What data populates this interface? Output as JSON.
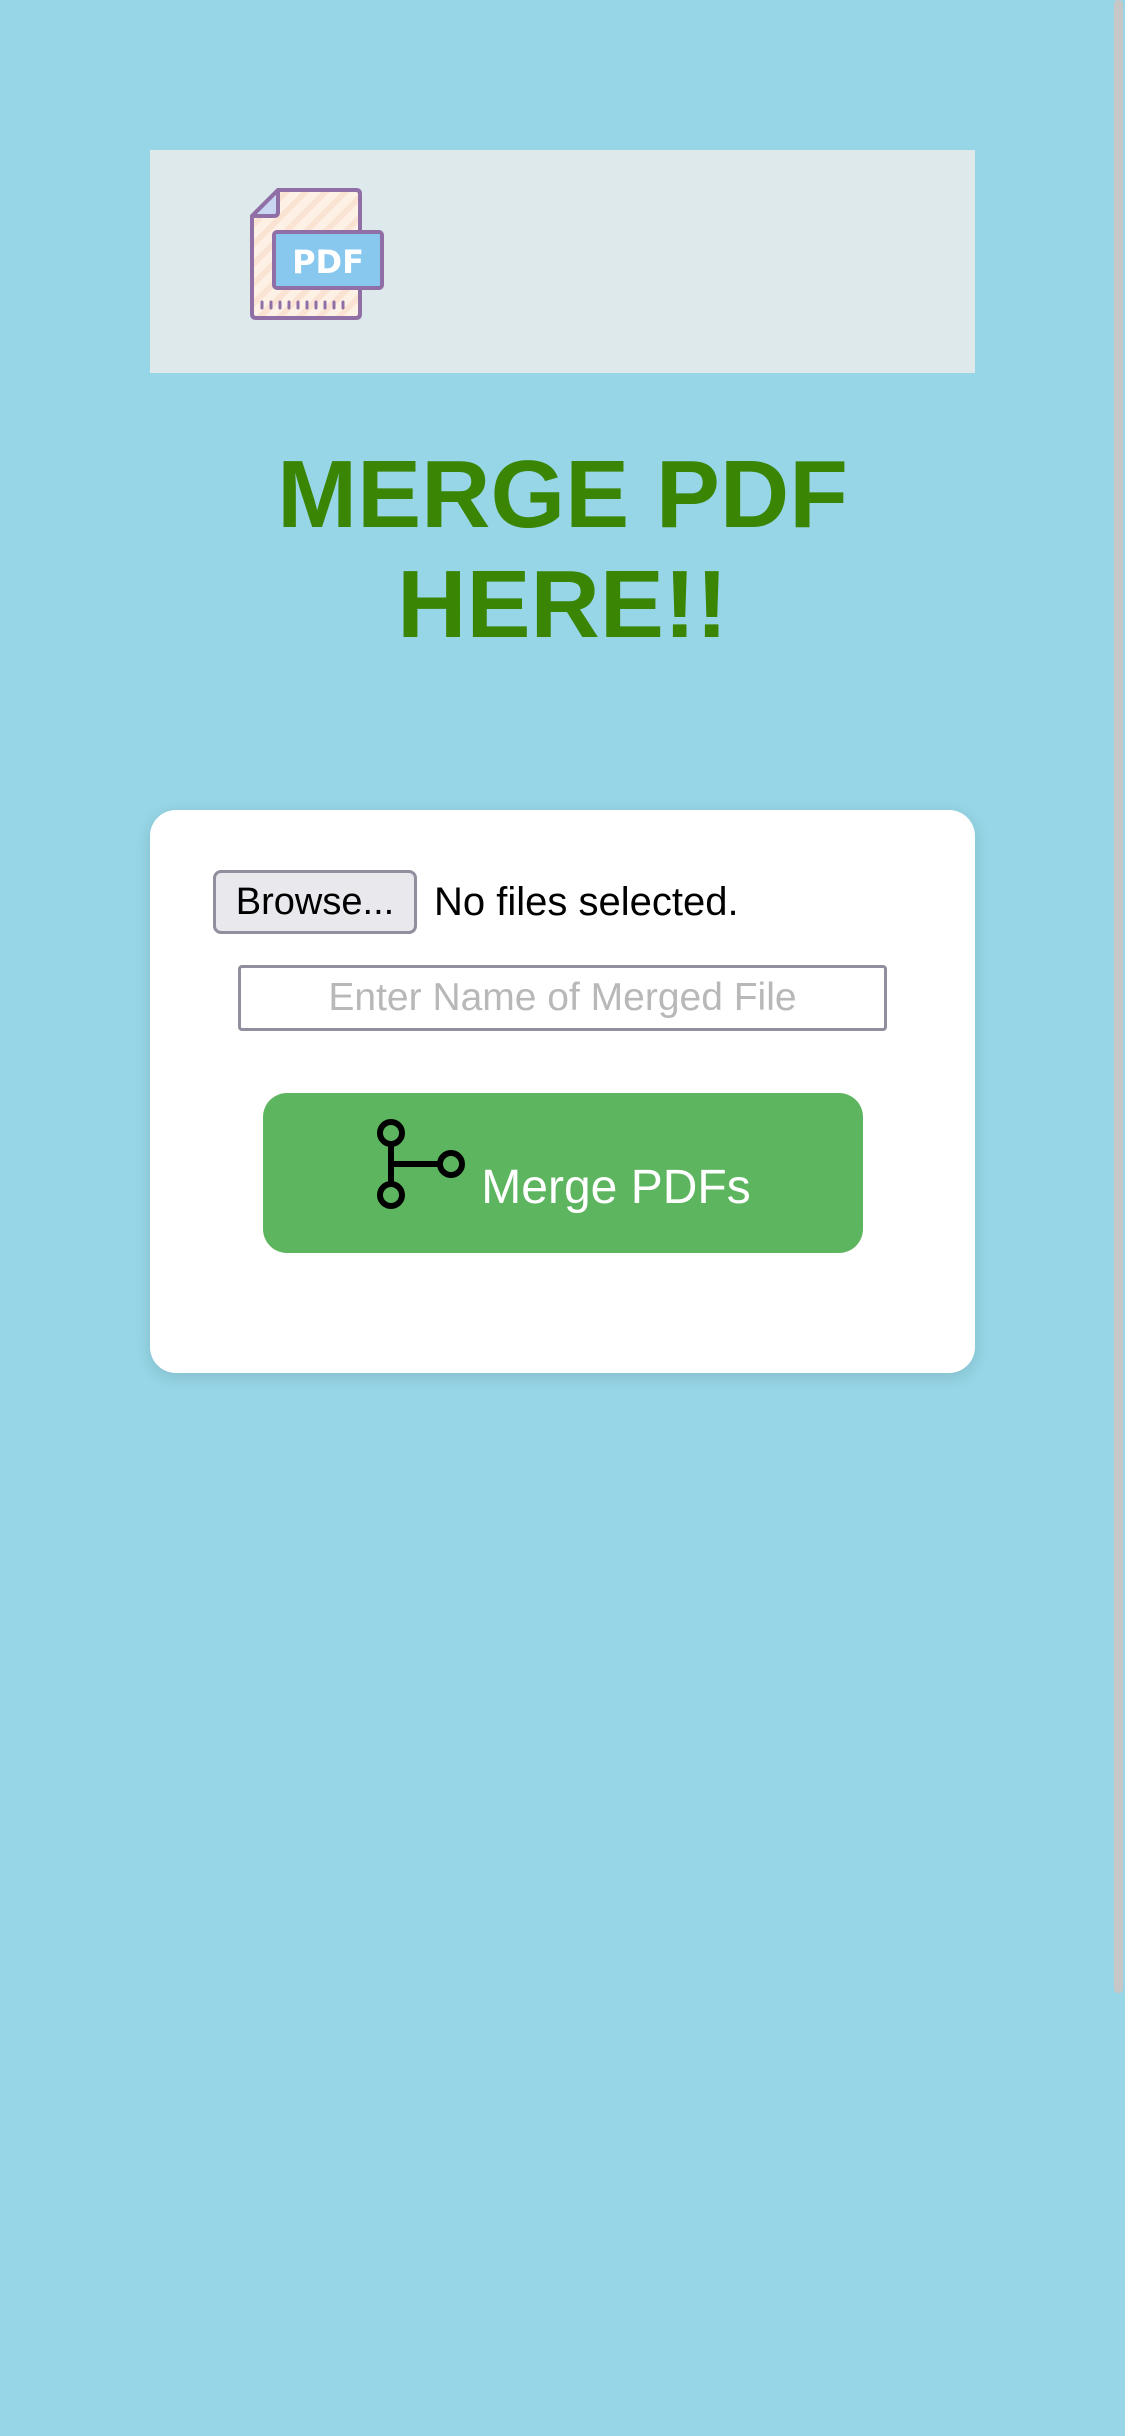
{
  "header": {
    "logo_text": "PDF",
    "logo_icon": "pdf-file-icon"
  },
  "page": {
    "title": "MERGE PDF HERE!!"
  },
  "form": {
    "browse_label": "Browse...",
    "file_status": "No files selected.",
    "merged_name_placeholder": "Enter Name of Merged File",
    "merged_name_value": "",
    "merge_label": "Merge PDFs",
    "merge_icon": "git-branch-merge-icon"
  },
  "colors": {
    "background": "#96d6e6",
    "banner": "#dde9ea",
    "title": "#3b8505",
    "card": "#ffffff",
    "merge_button": "#5db55f"
  }
}
